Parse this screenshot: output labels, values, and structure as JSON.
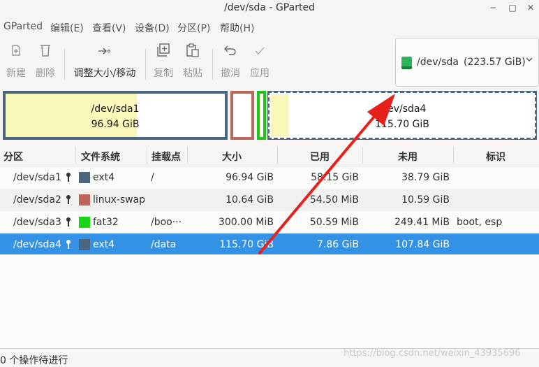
{
  "window": {
    "title": "/dev/sda - GParted"
  },
  "window_controls": [
    "−",
    "□",
    "✕"
  ],
  "menu": [
    "GParted",
    "编辑(E)",
    "查看(V)",
    "设备(D)",
    "分区(P)",
    "帮助(H)"
  ],
  "toolbar": {
    "new": "新建",
    "delete": "删除",
    "resize": "调整大小/移动",
    "copy": "复制",
    "paste": "粘贴",
    "undo": "撤消",
    "apply": "应用"
  },
  "device": {
    "name": "/dev/sda",
    "size": "(223.57 GiB)"
  },
  "diskmap": {
    "sda1": {
      "name": "/dev/sda1",
      "size": "96.94 GiB"
    },
    "sda4": {
      "name": "/dev/sda4",
      "size": "115.70 GiB"
    }
  },
  "columns": [
    "分区",
    "文件系统",
    "挂载点",
    "大小",
    "已用",
    "未用",
    "标识"
  ],
  "rows": [
    {
      "partition": "/dev/sda1",
      "fs": "ext4",
      "fs_color": "#4d6680",
      "mount": "/",
      "size": "96.94 GiB",
      "used": "58.15 GiB",
      "unused": "38.79 GiB",
      "flags": ""
    },
    {
      "partition": "/dev/sda2",
      "fs": "linux-swap",
      "fs_color": "#c0645a",
      "mount": "",
      "size": "10.64 GiB",
      "used": "54.50 MiB",
      "unused": "10.59 GiB",
      "flags": ""
    },
    {
      "partition": "/dev/sda3",
      "fs": "fat32",
      "fs_color": "#1ad41a",
      "mount": "/boo···",
      "size": "300.00 MiB",
      "used": "50.59 MiB",
      "unused": "249.41 MiB",
      "flags": "boot, esp"
    },
    {
      "partition": "/dev/sda4",
      "fs": "ext4",
      "fs_color": "#4d6680",
      "mount": "/data",
      "size": "115.70 GiB",
      "used": "7.86 GiB",
      "unused": "107.84 GiB",
      "flags": ""
    }
  ],
  "status": "0 个操作待进行",
  "watermark": "https://blog.csdn.net/weixin_43935696",
  "colors": {
    "selection": "#3391e6",
    "annotation_arrow": "#e8201c"
  }
}
